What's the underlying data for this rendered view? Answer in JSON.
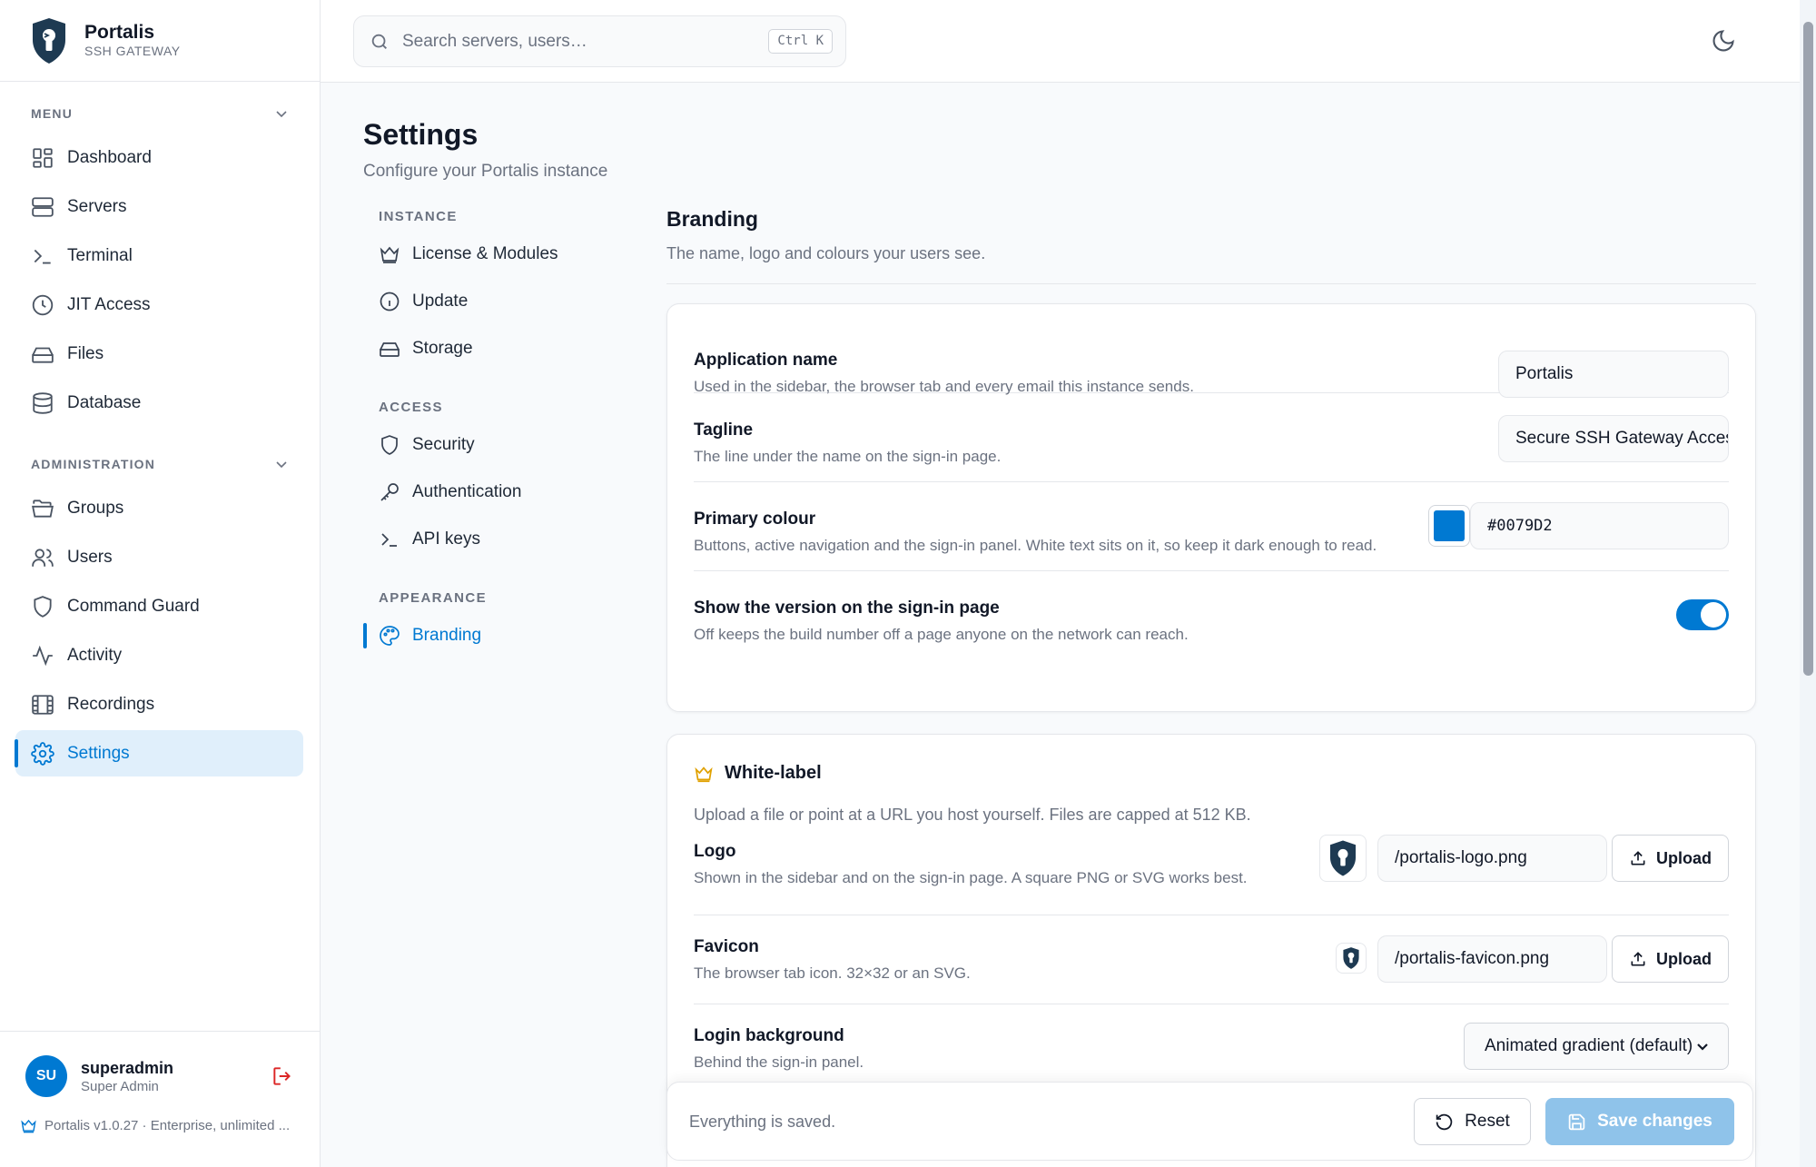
{
  "app": {
    "name": "Portalis",
    "subtitle": "SSH GATEWAY"
  },
  "search": {
    "placeholder": "Search servers, users…",
    "shortcut": "Ctrl K"
  },
  "sidebar": {
    "menu_label": "MENU",
    "menu_items": [
      {
        "label": "Dashboard",
        "icon": "dashboard-icon"
      },
      {
        "label": "Servers",
        "icon": "server-icon"
      },
      {
        "label": "Terminal",
        "icon": "terminal-icon"
      },
      {
        "label": "JIT Access",
        "icon": "clock-icon"
      },
      {
        "label": "Files",
        "icon": "drive-icon"
      },
      {
        "label": "Database",
        "icon": "database-icon"
      }
    ],
    "admin_label": "ADMINISTRATION",
    "admin_items": [
      {
        "label": "Groups",
        "icon": "folder-icon"
      },
      {
        "label": "Users",
        "icon": "users-icon"
      },
      {
        "label": "Command Guard",
        "icon": "shield-icon"
      },
      {
        "label": "Activity",
        "icon": "activity-icon"
      },
      {
        "label": "Recordings",
        "icon": "film-icon"
      },
      {
        "label": "Settings",
        "icon": "gear-icon",
        "active": true
      }
    ]
  },
  "user": {
    "initials": "SU",
    "name": "superadmin",
    "role": "Super Admin"
  },
  "version_text": "Portalis v1.0.27 · Enterprise, unlimited ...",
  "page": {
    "title": "Settings",
    "subtitle": "Configure your Portalis instance"
  },
  "settings_nav": {
    "instance_label": "INSTANCE",
    "instance_items": [
      {
        "label": "License & Modules",
        "icon": "crown-icon"
      },
      {
        "label": "Update",
        "icon": "info-icon"
      },
      {
        "label": "Storage",
        "icon": "drive-icon"
      }
    ],
    "access_label": "ACCESS",
    "access_items": [
      {
        "label": "Security",
        "icon": "shield-icon"
      },
      {
        "label": "Authentication",
        "icon": "key-icon"
      },
      {
        "label": "API keys",
        "icon": "terminal-icon"
      }
    ],
    "appearance_label": "APPEARANCE",
    "appearance_items": [
      {
        "label": "Branding",
        "icon": "palette-icon",
        "active": true
      }
    ]
  },
  "branding": {
    "title": "Branding",
    "subtitle": "The name, logo and colours your users see.",
    "app_name": {
      "label": "Application name",
      "desc": "Used in the sidebar, the browser tab and every email this instance sends.",
      "value": "Portalis"
    },
    "tagline": {
      "label": "Tagline",
      "desc": "The line under the name on the sign-in page.",
      "value": "Secure SSH Gateway Access"
    },
    "primary_colour": {
      "label": "Primary colour",
      "desc": "Buttons, active navigation and the sign-in panel. White text sits on it, so keep it dark enough to read.",
      "value": "#0079D2",
      "color": "#0079d2"
    },
    "show_version": {
      "label": "Show the version on the sign-in page",
      "desc": "Off keeps the build number off a page anyone on the network can reach.",
      "enabled": true
    }
  },
  "white_label": {
    "title": "White-label",
    "desc": "Upload a file or point at a URL you host yourself. Files are capped at 512 KB.",
    "logo": {
      "label": "Logo",
      "desc": "Shown in the sidebar and on the sign-in page. A square PNG or SVG works best.",
      "value": "/portalis-logo.png",
      "button": "Upload"
    },
    "favicon": {
      "label": "Favicon",
      "desc": "The browser tab icon. 32×32 or an SVG.",
      "value": "/portalis-favicon.png",
      "button": "Upload"
    },
    "login_bg": {
      "label": "Login background",
      "desc": "Behind the sign-in panel.",
      "value": "Animated gradient (default)"
    }
  },
  "footer": {
    "status": "Everything is saved.",
    "reset": "Reset",
    "save": "Save changes"
  },
  "colors": {
    "accent": "#0079d2",
    "accent_soft": "#e0effb",
    "save_disabled": "#8fc3ea",
    "logo_dark": "#1e3a52",
    "crown": "#e0a100"
  }
}
